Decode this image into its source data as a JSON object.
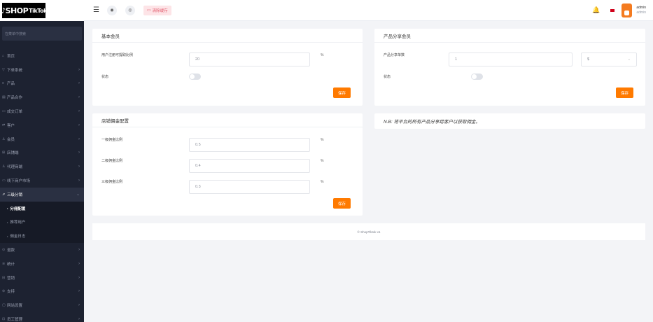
{
  "logo": {
    "main": "SHOP",
    "sub": "TikTok",
    "mark": "♪"
  },
  "sidebar": {
    "search_placeholder": "在菜单中搜索",
    "items": [
      {
        "icon": "⌂",
        "label": "首页",
        "arrow": ""
      },
      {
        "icon": "▽",
        "label": "下单系统",
        "arrow": "›"
      },
      {
        "icon": "≡",
        "label": "产品",
        "arrow": "›"
      },
      {
        "icon": "▤",
        "label": "产品合作",
        "arrow": "›"
      },
      {
        "icon": "▭",
        "label": "成交订单",
        "arrow": "›"
      },
      {
        "icon": "⇄",
        "label": "客户",
        "arrow": "›"
      },
      {
        "icon": "♙",
        "label": "会员",
        "arrow": "›"
      },
      {
        "icon": "⊞",
        "label": "店铺端",
        "arrow": "›"
      },
      {
        "icon": "♙",
        "label": "代理商端",
        "arrow": "›"
      },
      {
        "icon": "▭",
        "label": "线下商户市场",
        "arrow": "›"
      },
      {
        "icon": "⇗",
        "label": "三级分销",
        "arrow": "⌄"
      }
    ],
    "sub_items": [
      {
        "label": "分佣配置"
      },
      {
        "label": "推荐用户"
      },
      {
        "label": "佣金日志"
      }
    ],
    "items_after": [
      {
        "icon": "⊙",
        "label": "退款",
        "arrow": "›"
      },
      {
        "icon": "≋",
        "label": "统计",
        "arrow": "›"
      },
      {
        "icon": "⊟",
        "label": "营销",
        "arrow": "›"
      },
      {
        "icon": "⊘",
        "label": "支持",
        "arrow": "›"
      },
      {
        "icon": "▢",
        "label": "网站设置",
        "arrow": "›"
      },
      {
        "icon": "⊡",
        "label": "员工管理",
        "arrow": "›"
      }
    ]
  },
  "header": {
    "hamburger": "☰",
    "btn1": "◉",
    "btn2": "◎",
    "clear_icon": "▭",
    "clear_label": "清除缓存",
    "bell": "🔔",
    "admin_name": "admin",
    "admin_role": "admin"
  },
  "basic_member": {
    "title": "基本会员",
    "field_label": "用户注册可提取比例",
    "field_value": "20",
    "unit": "%",
    "status_label": "状态",
    "save": "保存"
  },
  "product_share": {
    "title": "产品分享会员",
    "field_label": "产品分享单数",
    "field_value": "1",
    "select_value": "$",
    "select_arrow": "⌄",
    "status_label": "状态",
    "save": "保存"
  },
  "commission": {
    "title": "店铺佣金配置",
    "rows": [
      {
        "label": "一级佣金比例",
        "value": "0.5",
        "unit": "%"
      },
      {
        "label": "二级佣金比例",
        "value": "0.4",
        "unit": "%"
      },
      {
        "label": "三级佣金比例",
        "value": "0.3",
        "unit": "%"
      }
    ],
    "save": "保存"
  },
  "note": "N.B: 将平台的所有产品分享给客户以获取佣金。",
  "footer": "© ShopTiktok v1"
}
